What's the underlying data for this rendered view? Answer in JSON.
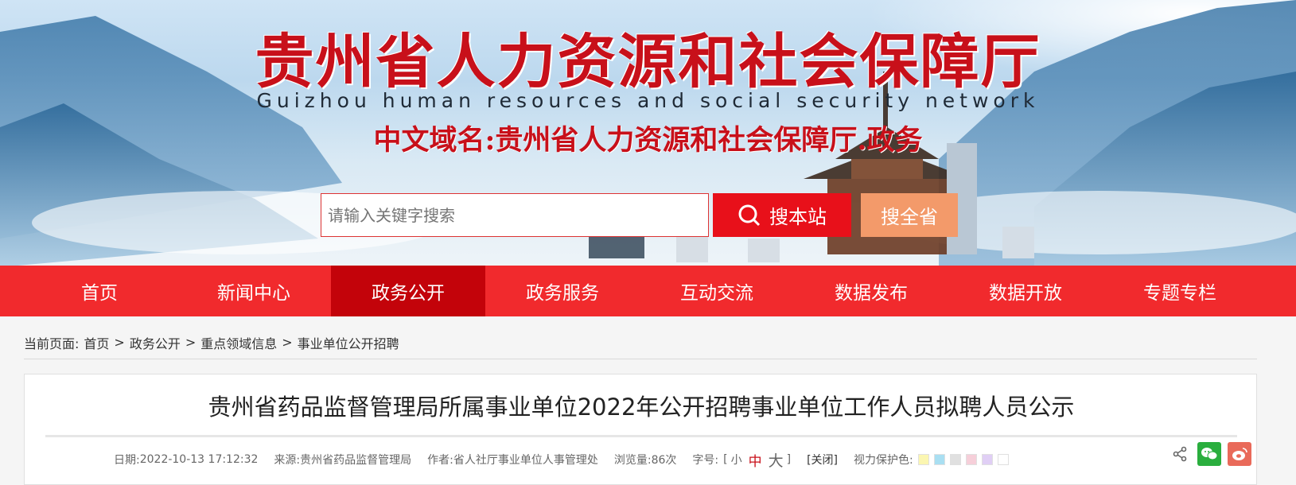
{
  "banner": {
    "title": "贵州省人力资源和社会保障厅",
    "subtitle": "Guizhou human resources and social security network",
    "domain": "中文域名:贵州省人力资源和社会保障厅.政务"
  },
  "search": {
    "placeholder": "请输入关键字搜索",
    "btn_site": "搜本站",
    "btn_province": "搜全省"
  },
  "nav": {
    "items": [
      {
        "label": "首页"
      },
      {
        "label": "新闻中心"
      },
      {
        "label": "政务公开"
      },
      {
        "label": "政务服务"
      },
      {
        "label": "互动交流"
      },
      {
        "label": "数据发布"
      },
      {
        "label": "数据开放"
      },
      {
        "label": "专题专栏"
      }
    ],
    "active_index": 2
  },
  "breadcrumb": {
    "prefix": "当前页面:",
    "items": [
      "首页",
      "政务公开",
      "重点领域信息",
      "事业单位公开招聘"
    ],
    "separator": ">"
  },
  "article": {
    "title": "贵州省药品监督管理局所属事业单位2022年公开招聘事业单位工作人员拟聘人员公示",
    "date_label": "日期:",
    "date": "2022-10-13 17:12:32",
    "source_label": "来源:",
    "source": "贵州省药品监督管理局",
    "author_label": "作者:",
    "author": "省人社厅事业单位人事管理处",
    "views_label": "浏览量:",
    "views": "86次",
    "fontsize_label": "字号:",
    "fontsize_open": "[",
    "fontsize_small": "小",
    "fontsize_medium": "中",
    "fontsize_large": "大",
    "fontsize_close": "]",
    "close": "[关闭]",
    "eye_label": "视力保护色:",
    "eye_colors": [
      "#fbf6b1",
      "#a9dff2",
      "#e0e0e0",
      "#f6cfd9",
      "#e0cff5",
      "#ffffff"
    ]
  },
  "colors": {
    "brand_red": "#f12a2d",
    "nav_active": "#c3030a",
    "title_red": "#c8101a",
    "btn_site": "#e8101a",
    "btn_province": "#f39a6a"
  }
}
